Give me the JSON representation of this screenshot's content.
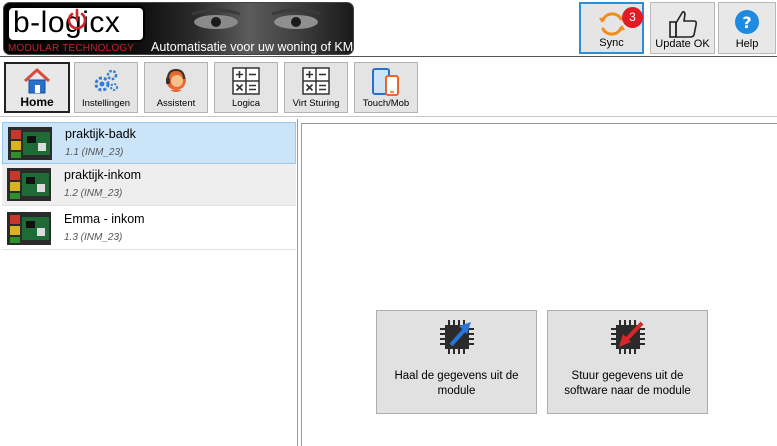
{
  "header": {
    "logo_name": "b-logicx",
    "logo_sub": "MODULAR TECHNOLOGY",
    "logo_tagline": "Automatisatie voor uw woning of KMO",
    "sync": {
      "label": "Sync",
      "badge": "3",
      "icon": "sync-icon"
    },
    "update": {
      "label": "Update OK",
      "icon": "thumbs-up-icon"
    },
    "help": {
      "label": "Help",
      "icon": "question-icon"
    }
  },
  "toolbar": {
    "items": [
      {
        "label": "Home",
        "icon": "home-icon"
      },
      {
        "label": "Instellingen",
        "icon": "gears-icon"
      },
      {
        "label": "Assistent",
        "icon": "assistant-icon"
      },
      {
        "label": "Logica",
        "icon": "calculator-icon"
      },
      {
        "label": "Virt Sturing",
        "icon": "calculator-icon"
      },
      {
        "label": "Touch/Mob",
        "icon": "devices-icon"
      }
    ]
  },
  "modules": [
    {
      "name": "praktijk-badk",
      "sub": "1.1 (INM_23)",
      "selected": true
    },
    {
      "name": "praktijk-inkom",
      "sub": "1.2 (INM_23)",
      "selected": false
    },
    {
      "name": "Emma - inkom",
      "sub": "1.3 (INM_23)",
      "selected": false
    }
  ],
  "actions": {
    "get": {
      "label": "Haal de gegevens uit de module",
      "icon": "chip-download-icon"
    },
    "send": {
      "label": "Stuur gegevens uit de software naar de module",
      "icon": "chip-upload-icon"
    }
  },
  "colors": {
    "accent": "#2a8fd8",
    "badge": "#e21b24",
    "selection": "#cce4f7"
  }
}
